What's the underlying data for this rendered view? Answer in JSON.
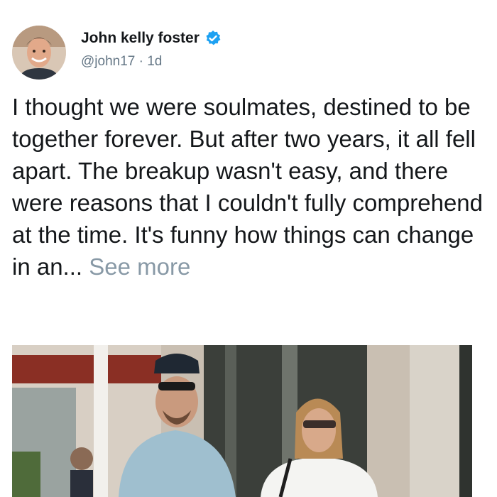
{
  "author": {
    "name": "John kelly foster",
    "verified": true,
    "handle": "@john17",
    "separator": "·",
    "time": "1d"
  },
  "tweet": {
    "text": "I thought we were soulmates, destined to be together forever. But after two years, it all fell apart. The breakup wasn't easy, and there were reasons that I couldn't fully comprehend at the time. It's funny how things can change in an...",
    "see_more": "See more"
  },
  "colors": {
    "verified_badge": "#1da1f2",
    "secondary_text": "#657786",
    "see_more": "#8899a6"
  },
  "icons": {
    "verified": "verified-badge-icon"
  }
}
